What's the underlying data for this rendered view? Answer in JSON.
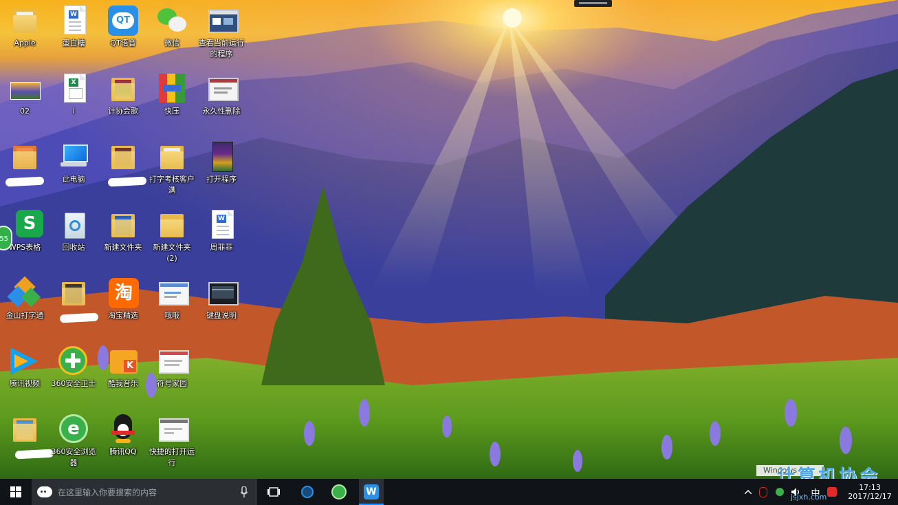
{
  "desktop": {
    "icons": [
      {
        "label": "Apple"
      },
      {
        "label": "蛋白糖"
      },
      {
        "label": "QT语音",
        "glyph": "QT"
      },
      {
        "label": "微信"
      },
      {
        "label": "查看当前运行的程序"
      },
      {
        "label": "02"
      },
      {
        "label": "i"
      },
      {
        "label": "计协会歌"
      },
      {
        "label": "快压"
      },
      {
        "label": "永久性删除"
      },
      {
        "label": "此电脑"
      },
      {
        "label": "打字考核客户满"
      },
      {
        "label": "打开程序"
      },
      {
        "label": "WPS表格",
        "glyph": "S"
      },
      {
        "label": "回收站"
      },
      {
        "label": "新建文件夹"
      },
      {
        "label": "新建文件夹 (2)"
      },
      {
        "label": "周菲菲"
      },
      {
        "label": "金山打字通"
      },
      {
        "label": "淘宝精选",
        "glyph": "淘"
      },
      {
        "label": "哦哦"
      },
      {
        "label": "键盘说明"
      },
      {
        "label": "腾讯视频"
      },
      {
        "label": "360安全卫士"
      },
      {
        "label": "酷我音乐",
        "glyph": "K"
      },
      {
        "label": "符号家园"
      },
      {
        "label": "360安全浏览器"
      },
      {
        "label": "腾讯QQ"
      },
      {
        "label": "快捷的打开运行"
      }
    ],
    "float_badge": "55"
  },
  "taskbar": {
    "search_placeholder": "在这里输入你要搜索的内容",
    "clock_time": "17:13",
    "clock_date": "2017/12/17",
    "ime_label": "中",
    "watermark_activate": "Windows Ink",
    "watermark_site": "计算机协会",
    "watermark_url": "jsjxh.com"
  },
  "colors": {
    "taskbar_bg": "#101418",
    "search_bg": "#2b2f33",
    "accent": "#1e90ff"
  },
  "icons": [
    "windows-logo-icon",
    "cortana-icon",
    "microphone-icon",
    "task-view-icon",
    "kugou-icon",
    "browser-360-icon",
    "wps-icon"
  ]
}
